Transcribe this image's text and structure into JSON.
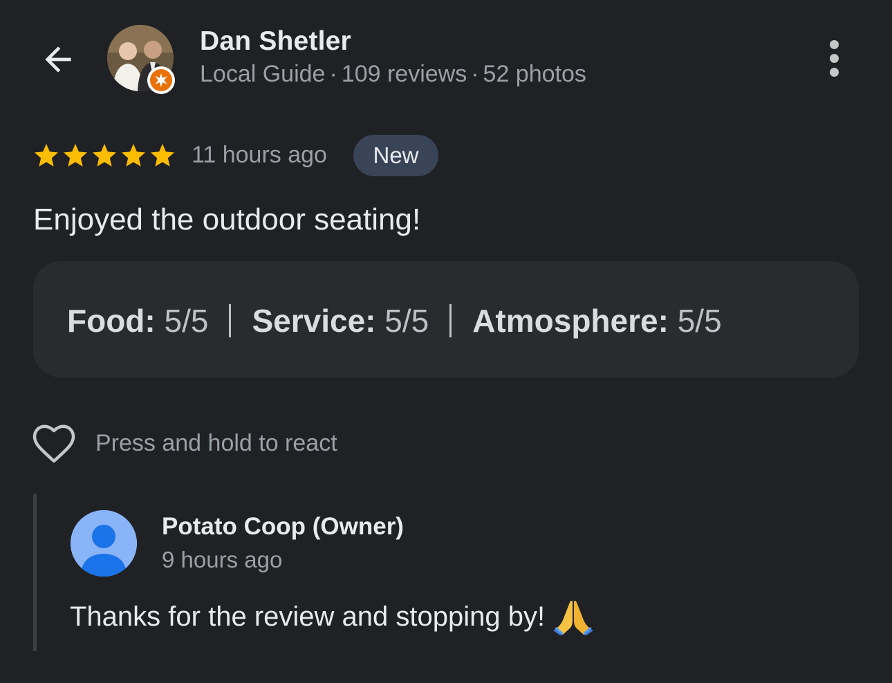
{
  "reviewer": {
    "name": "Dan Shetler",
    "guide_label": "Local Guide",
    "reviews": "109 reviews",
    "photos": "52 photos",
    "separator": "·"
  },
  "review": {
    "rating": 5,
    "max_rating": 5,
    "time_ago": "11 hours ago",
    "badge": "New",
    "text": "Enjoyed the outdoor seating!",
    "ratings": [
      {
        "label": "Food:",
        "value": "5/5"
      },
      {
        "label": "Service:",
        "value": "5/5"
      },
      {
        "label": "Atmosphere:",
        "value": "5/5"
      }
    ]
  },
  "react": {
    "label": "Press and hold to react"
  },
  "owner_reply": {
    "name": "Potato Coop (Owner)",
    "time_ago": "9 hours ago",
    "text": "Thanks for the review and stopping by!"
  },
  "colors": {
    "background": "#202124",
    "star": "#fbbc04",
    "badge_bg": "#394457",
    "card_bg": "#2a2b2e",
    "guide_badge": "#e8710a",
    "owner_avatar": "#8ab4f8",
    "owner_avatar_figure": "#1a73e8"
  },
  "icons": {
    "back": "arrow-back-icon",
    "more": "more-vert-icon",
    "star": "star-icon",
    "heart": "heart-outline-icon",
    "guide_badge": "local-guide-star-icon",
    "reply_emoji": "folded-hands-emoji"
  }
}
